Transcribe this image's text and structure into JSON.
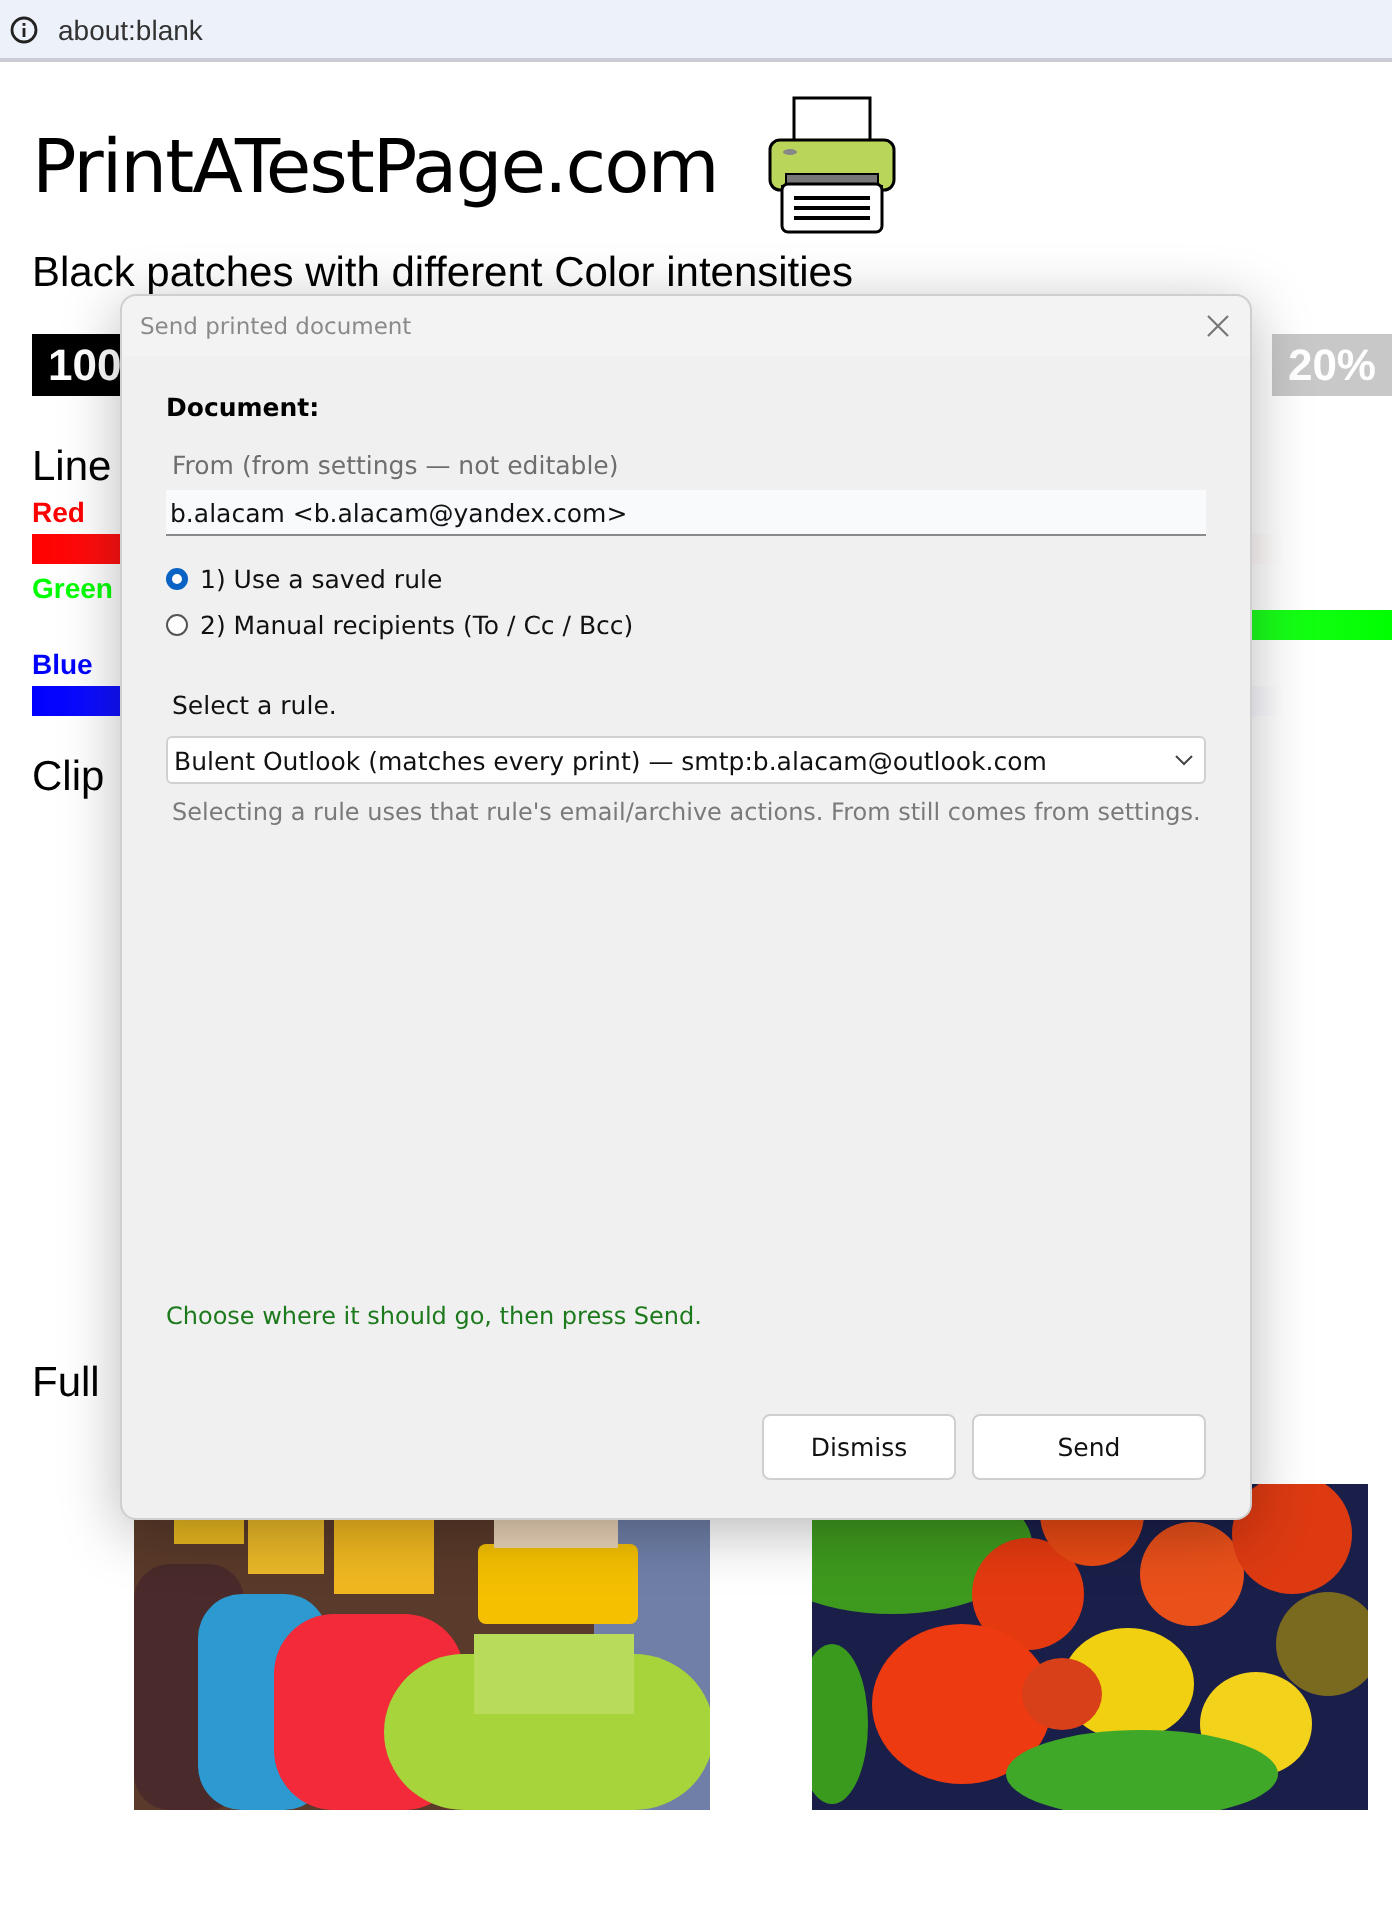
{
  "address_bar": {
    "url": "about:blank"
  },
  "page": {
    "logo": "PrintATestPage.com",
    "heading": "Black patches with different Color intensities",
    "patches": [
      {
        "label": "100",
        "color": "#000000"
      },
      {
        "label": "20%",
        "color": "#c8c8c8"
      }
    ],
    "linear_heading": "Line",
    "gradients": [
      {
        "label": "Red",
        "color": "#ff0000",
        "kind": "fade_right"
      },
      {
        "label": "Green",
        "color": "#00ff00",
        "kind": "fade_left"
      },
      {
        "label": "Blue",
        "color": "#0000ff",
        "kind": "fade_right"
      }
    ],
    "clip_heading": "Clip",
    "full_heading": "Full"
  },
  "dialog": {
    "title": "Send printed document",
    "section": "Document:",
    "from_label": "From (from settings — not editable)",
    "from_value": "b.alacam <b.alacam@yandex.com>",
    "options": [
      {
        "label": "1) Use a saved rule",
        "selected": true
      },
      {
        "label": "2) Manual recipients (To / Cc / Bcc)",
        "selected": false
      }
    ],
    "rule_label": "Select a rule.",
    "rule_value": "Bulent Outlook (matches every print) — smtp:b.alacam@outlook.com",
    "hint": "Selecting a rule uses that rule's email/archive actions. From still comes from settings.",
    "status": "Choose where it should go, then press Send.",
    "buttons": [
      "Dismiss",
      "Send"
    ]
  }
}
